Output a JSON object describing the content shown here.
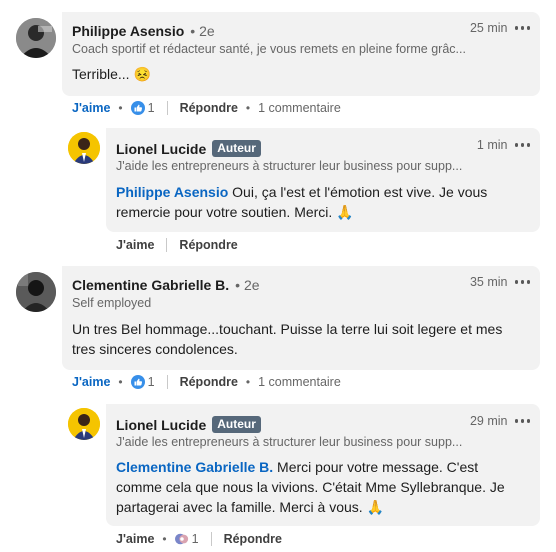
{
  "comments": [
    {
      "author": "Philippe Asensio",
      "degree": "2e",
      "headline": "Coach sportif et rédacteur santé, je vous remets en pleine forme grâc...",
      "time": "25 min",
      "text": "Terrible... 😣",
      "like_label": "J'aime",
      "reaction_count": "1",
      "reply_label": "Répondre",
      "replies_count": "1 commentaire",
      "reply": {
        "author": "Lionel Lucide",
        "badge": "Auteur",
        "headline": "J'aide les entrepreneurs à structurer leur business pour supp...",
        "time": "1 min",
        "mention": "Philippe Asensio",
        "text": " Oui, ça l'est et l'émotion est vive. Je vous remercie pour votre soutien. Merci. 🙏",
        "like_label": "J'aime",
        "reply_label": "Répondre"
      }
    },
    {
      "author": "Clementine Gabrielle B.",
      "degree": "2e",
      "headline": "Self employed",
      "time": "35 min",
      "text": "Un tres Bel hommage...touchant. Puisse la terre lui soit legere et mes tres sinceres condolences.",
      "like_label": "J'aime",
      "reaction_count": "1",
      "reply_label": "Répondre",
      "replies_count": "1 commentaire",
      "reply": {
        "author": "Lionel Lucide",
        "badge": "Auteur",
        "headline": "J'aide les entrepreneurs à structurer leur business pour supp...",
        "time": "29 min",
        "mention": "Clementine Gabrielle B.",
        "text": " Merci pour votre message. C'est comme cela que nous la vivions. C'était Mme Syllebranque. Je partagerai avec la famille. Merci à vous. 🙏",
        "like_label": "J'aime",
        "reaction_count": "1",
        "reply_label": "Répondre"
      }
    }
  ],
  "colors": {
    "link_blue": "#0a66c2",
    "bubble_bg": "#f2f2f2",
    "badge_bg": "#56687a",
    "avatar_lionel_bg": "#f5c400"
  },
  "icons": {
    "like_reaction": "like-reaction-icon",
    "multi_reaction": "multi-reaction-icon",
    "more": "more-options-icon"
  }
}
